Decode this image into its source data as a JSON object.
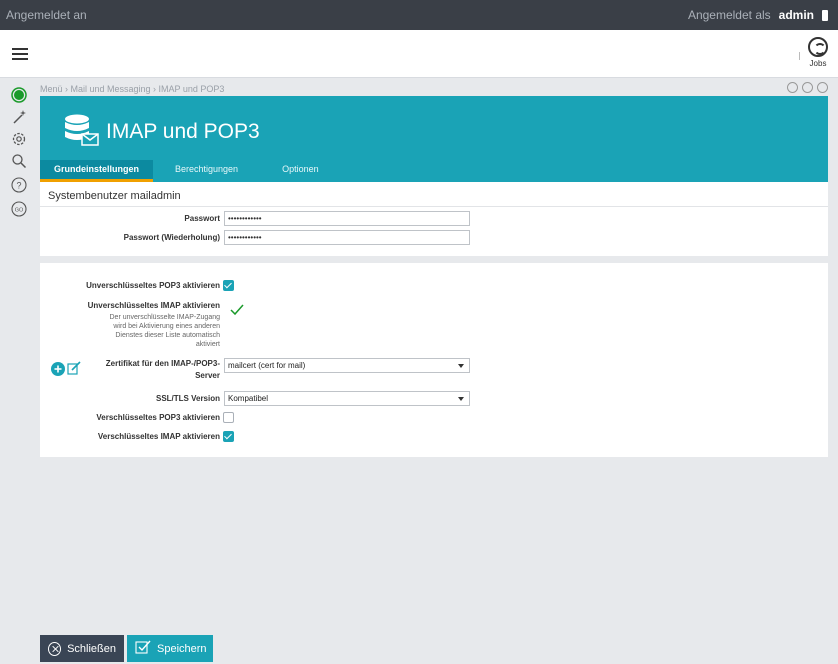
{
  "topbar": {
    "status": "Angemeldet an",
    "logged_as": "Angemeldet als",
    "user": "admin"
  },
  "header": {
    "jobs_label": "Jobs"
  },
  "sidebar": {
    "icons": [
      "status-icon",
      "wizard-icon",
      "settings-icon",
      "search-icon",
      "help-icon",
      "go-icon"
    ]
  },
  "breadcrumb": "Menü › Mail und Messaging › IMAP und POP3",
  "page": {
    "title": "IMAP und POP3"
  },
  "tabs": [
    {
      "label": "Grundeinstellungen",
      "active": true
    },
    {
      "label": "Berechtigungen",
      "active": false
    },
    {
      "label": "Optionen",
      "active": false
    }
  ],
  "system_user": {
    "title": "Systembenutzer mailadmin",
    "password_label": "Passwort",
    "password_value": "••••••••••••",
    "password_repeat_label": "Passwort (Wiederholung)",
    "password_repeat_value": "••••••••••••"
  },
  "settings": {
    "pop3_unencrypted_label": "Unverschlüsseltes POP3 aktivieren",
    "pop3_unencrypted_checked": true,
    "imap_unencrypted_label": "Unverschlüsseltes IMAP aktivieren",
    "imap_unencrypted_checked": true,
    "imap_hint_1": "Der unverschlüsselte IMAP-Zugang",
    "imap_hint_2": "wird bei Aktivierung eines anderen",
    "imap_hint_3": "Dienstes dieser Liste automatisch",
    "imap_hint_4": "aktiviert",
    "cert_label_1": "Zertifikat für den IMAP-/POP3-",
    "cert_label_2": "Server",
    "cert_value": "mailcert (cert for mail)",
    "tls_label": "SSL/TLS Version",
    "tls_value": "Kompatibel",
    "pop3_encrypted_label": "Verschlüsseltes POP3 aktivieren",
    "pop3_encrypted_checked": false,
    "imap_encrypted_label": "Verschlüsseltes IMAP aktivieren",
    "imap_encrypted_checked": true
  },
  "footer": {
    "close_label": "Schließen",
    "save_label": "Speichern"
  },
  "colors": {
    "accent": "#1aa3b6",
    "tab_active_underline": "#f0a000",
    "topbar": "#3a3f47",
    "status_green": "#1a9a2a"
  }
}
